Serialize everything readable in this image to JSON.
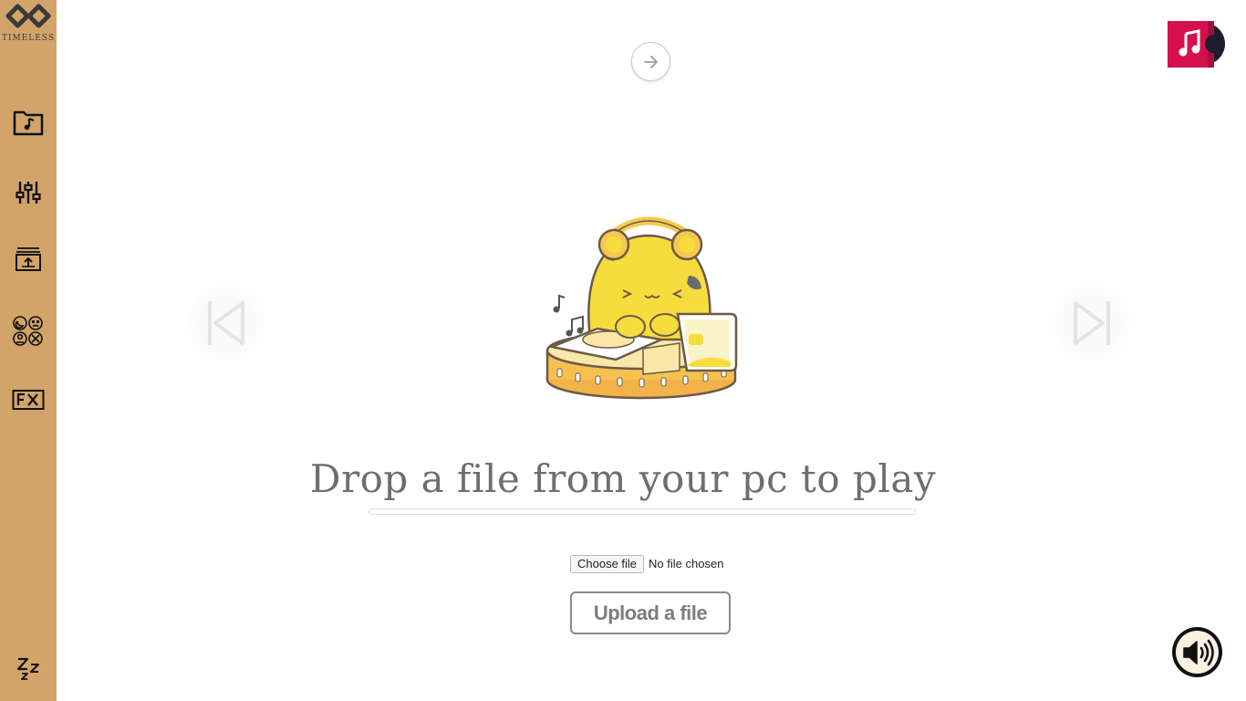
{
  "app": {
    "logo_text": "TIMELESS",
    "accent_color": "#d2a46a"
  },
  "sidebar": {
    "items": [
      {
        "icon": "music-folder-icon"
      },
      {
        "icon": "sliders-icon"
      },
      {
        "icon": "upload-folder-icon"
      },
      {
        "icon": "moods-icon"
      },
      {
        "icon": "fx-icon"
      },
      {
        "icon": "sleep-icon"
      }
    ]
  },
  "top": {
    "arrow_icon": "arrow-right-icon",
    "music_icon": "music-note-icon",
    "music_badge_color": "#d4114e"
  },
  "player": {
    "prev_icon": "skip-previous-icon",
    "next_icon": "skip-next-icon"
  },
  "drop": {
    "title": "Drop a file from your pc to play"
  },
  "file_input": {
    "button_label": "Choose file",
    "status_text": "No file chosen"
  },
  "upload": {
    "label": "Upload a file"
  },
  "volume": {
    "icon": "volume-icon"
  }
}
